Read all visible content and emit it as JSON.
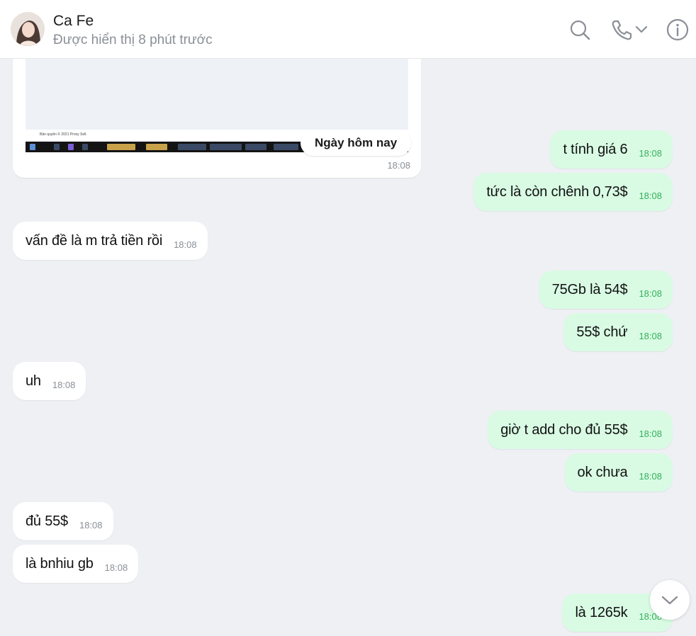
{
  "header": {
    "title": "Ca Fe",
    "subtitle": "Được hiển thị 8 phút trước"
  },
  "icons": {
    "search": "search-icon",
    "call": "phone-icon",
    "call_menu": "chevron-down-icon",
    "info": "info-icon",
    "scroll_down": "chevron-down-icon"
  },
  "colors": {
    "incoming_bubble": "#ffffff",
    "outgoing_bubble": "#d9fbe4",
    "outgoing_time": "#35b05a",
    "chat_background": "#eef0f4"
  },
  "image_message": {
    "date_separator": "Ngày hôm nay",
    "time": "18:08",
    "screenshot_footer": "Bản quyền © 2021 Proxy Sell."
  },
  "messages": [
    {
      "dir": "out",
      "text": "t tính giá 6",
      "time": "18:08"
    },
    {
      "dir": "out",
      "text": "tức là còn chênh 0,73$",
      "time": "18:08"
    },
    {
      "dir": "in",
      "text": "vấn đề là m trả tiền rồi",
      "time": "18:08"
    },
    {
      "dir": "out",
      "text": "75Gb là 54$",
      "time": "18:08"
    },
    {
      "dir": "out",
      "text": "55$ chứ",
      "time": "18:08"
    },
    {
      "dir": "in",
      "text": "uh",
      "time": "18:08"
    },
    {
      "dir": "out",
      "text": "giờ t add cho đủ 55$",
      "time": "18:08"
    },
    {
      "dir": "out",
      "text": "ok chưa",
      "time": "18:08"
    },
    {
      "dir": "in",
      "text": "đủ 55$",
      "time": "18:08"
    },
    {
      "dir": "in",
      "text": "là bnhiu gb",
      "time": "18:08"
    },
    {
      "dir": "out",
      "text": "là 1265k",
      "time": "18:08"
    }
  ]
}
